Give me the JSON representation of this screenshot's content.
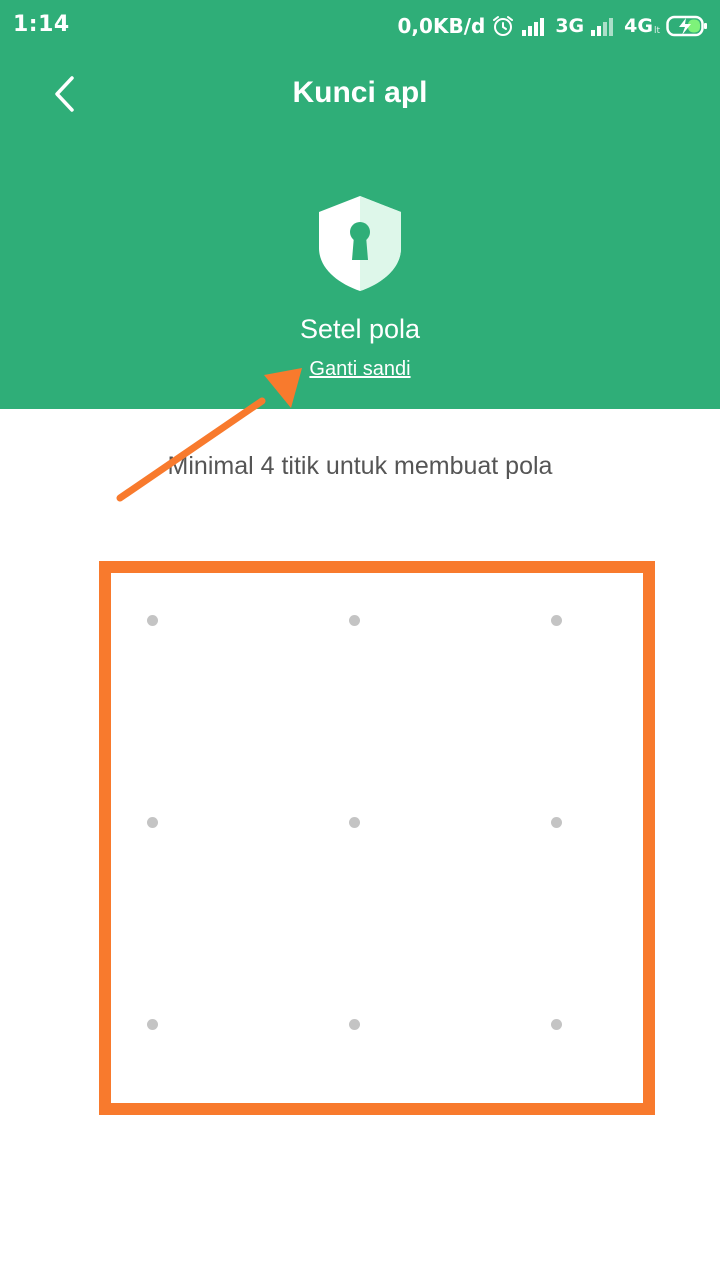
{
  "status_bar": {
    "time": "1:14",
    "data_rate": "0,0KB/d",
    "network_1": "3G",
    "network_2": "4G",
    "network_2_sub": "lt"
  },
  "header": {
    "title": "Kunci apl",
    "icon": "shield-keyhole-icon",
    "pattern_title": "Setel pola",
    "change_link": "Ganti sandi"
  },
  "main": {
    "hint": "Minimal 4 titik untuk membuat pola"
  },
  "colors": {
    "header_bg": "#2fae78",
    "highlight": "#f87a2d",
    "dot": "#c4c4c4"
  }
}
